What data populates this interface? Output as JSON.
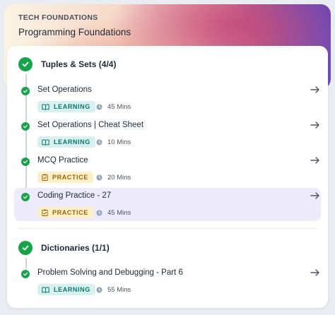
{
  "course": {
    "subtitle": "TECH FOUNDATIONS",
    "title": "Programming Foundations"
  },
  "sections": [
    {
      "title": "Tuples & Sets (4/4)",
      "items": [
        {
          "title": "Set Operations",
          "type": "LEARNING",
          "duration": "45 Mins",
          "active": false
        },
        {
          "title": "Set Operations | Cheat Sheet",
          "type": "LEARNING",
          "duration": "10 Mins",
          "active": false
        },
        {
          "title": "MCQ Practice",
          "type": "PRACTICE",
          "duration": "20 Mins",
          "active": false
        },
        {
          "title": "Coding Practice - 27",
          "type": "PRACTICE",
          "duration": "45 Mins",
          "active": true
        }
      ]
    },
    {
      "title": "Dictionaries (1/1)",
      "items": [
        {
          "title": "Problem Solving and Debugging - Part 6",
          "type": "LEARNING",
          "duration": "55 Mins",
          "active": false
        }
      ]
    }
  ],
  "colors": {
    "complete": "#16a34a",
    "learning_bg": "#d6f1ee",
    "learning_text": "#0f766e",
    "practice_bg": "#fdf0c8",
    "practice_text": "#a16207",
    "active_row": "#eceafb"
  },
  "icons": {
    "check": "check-icon",
    "learning": "book-icon",
    "practice": "clipboard-icon",
    "time": "clock-icon",
    "open": "arrow-right-icon"
  }
}
